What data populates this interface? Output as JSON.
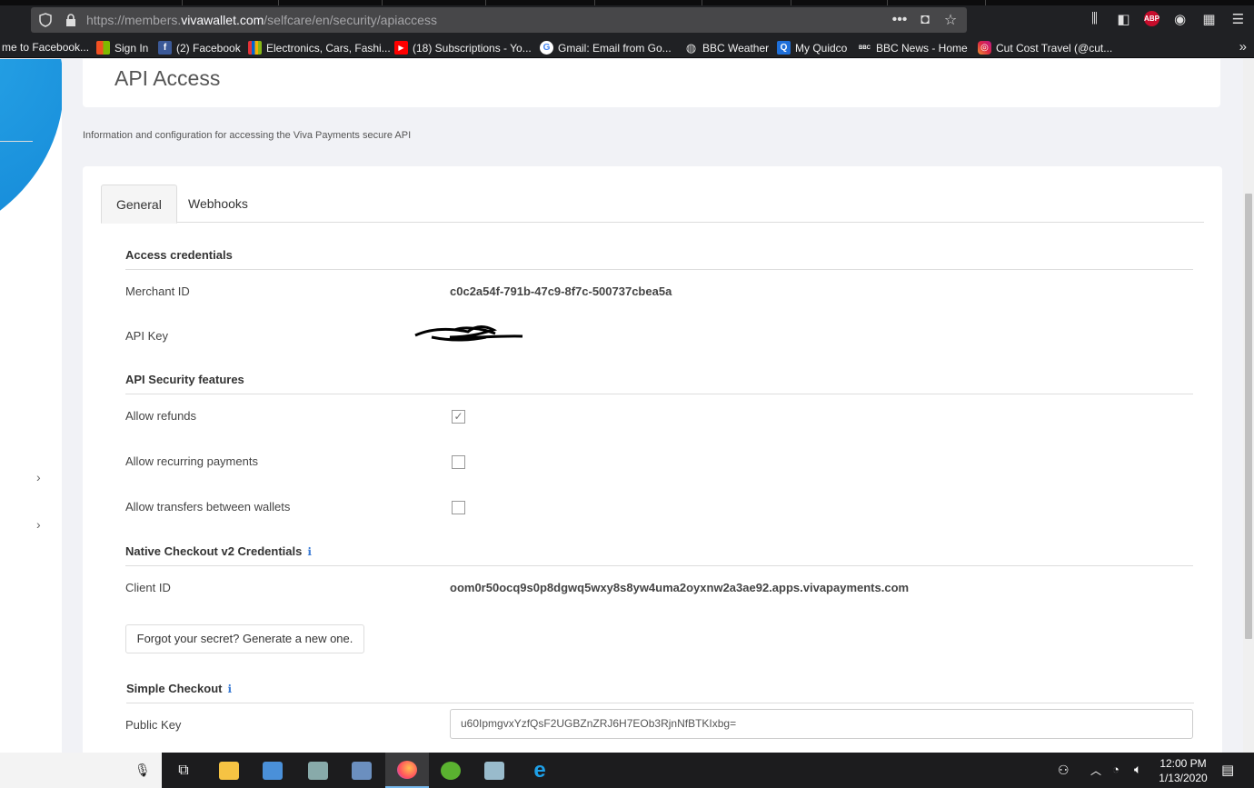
{
  "browser": {
    "url_prefix": "https://members.",
    "url_domain": "vivawallet.com",
    "url_path": "/selfcare/en/security/apiaccess",
    "menu_icon": "hamburger-icon"
  },
  "bookmarks": [
    {
      "label": "me to Facebook...",
      "icon": "none"
    },
    {
      "label": "Sign In",
      "icon": "windows"
    },
    {
      "label": "(2) Facebook",
      "icon": "facebook"
    },
    {
      "label": "Electronics, Cars, Fashi...",
      "icon": "ebay"
    },
    {
      "label": "(18) Subscriptions - Yo...",
      "icon": "youtube"
    },
    {
      "label": "Gmail: Email from Go...",
      "icon": "google"
    },
    {
      "label": "BBC Weather",
      "icon": "globe"
    },
    {
      "label": "My Quidco",
      "icon": "quidco"
    },
    {
      "label": "BBC News - Home",
      "icon": "bbc"
    },
    {
      "label": "Cut Cost Travel (@cut...",
      "icon": "instagram"
    }
  ],
  "page": {
    "title": "API Access",
    "subtitle": "Information and configuration for accessing the Viva Payments secure API"
  },
  "tabs": {
    "general": "General",
    "webhooks": "Webhooks"
  },
  "credentials": {
    "heading": "Access credentials",
    "merchant_id_label": "Merchant ID",
    "merchant_id_value": "c0c2a54f-791b-47c9-8f7c-500737cbea5a",
    "api_key_label": "API Key"
  },
  "security": {
    "heading": "API Security features",
    "allow_refunds": "Allow refunds",
    "allow_refunds_checked": true,
    "allow_recurring": "Allow recurring payments",
    "allow_recurring_checked": false,
    "allow_transfers": "Allow transfers between wallets",
    "allow_transfers_checked": false
  },
  "native_checkout": {
    "heading": "Native Checkout v2 Credentials",
    "client_id_label": "Client ID",
    "client_id_value": "oom0r50ocq9s0p8dgwq5wxy8s8yw4uma2oyxnw2a3ae92.apps.vivapayments.com",
    "forgot_button": "Forgot your secret? Generate a new one."
  },
  "simple_checkout": {
    "heading": "Simple Checkout",
    "public_key_label": "Public Key",
    "public_key_value": "u60IpmgvxYzfQsF2UGBZnZRJ6H7EOb3RjnNfBTKIxbg="
  },
  "taskbar": {
    "time": "12:00 PM",
    "date": "1/13/2020"
  },
  "colors": {
    "accent": "#3a7bd5",
    "sidebar_blue": "#1a8fdc"
  }
}
